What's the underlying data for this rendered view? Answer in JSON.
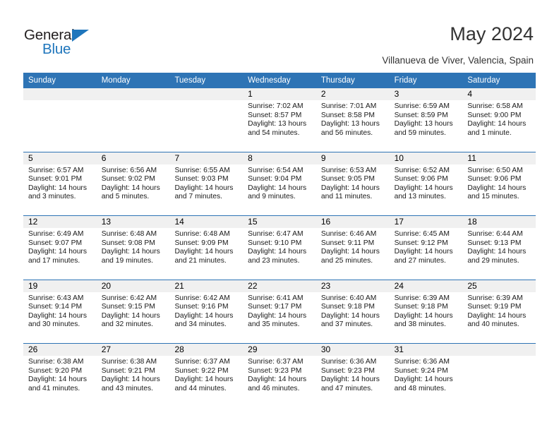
{
  "brand": {
    "name_top": "General",
    "name_bottom": "Blue",
    "triangle_color": "#1f76bc",
    "text_color": "#231f20"
  },
  "header": {
    "title": "May 2024",
    "subtitle": "Villanueva de Viver, Valencia, Spain"
  },
  "theme": {
    "header_blue": "#2e74b5",
    "daynum_band": "#f0f0f0",
    "cell_background": "#ffffff",
    "text": "#1a1a1a"
  },
  "weekdays": [
    "Sunday",
    "Monday",
    "Tuesday",
    "Wednesday",
    "Thursday",
    "Friday",
    "Saturday"
  ],
  "weeks": [
    [
      {
        "day": "",
        "sunrise": "",
        "sunset": "",
        "daylight1": "",
        "daylight2": "",
        "empty": true
      },
      {
        "day": "",
        "sunrise": "",
        "sunset": "",
        "daylight1": "",
        "daylight2": "",
        "empty": true
      },
      {
        "day": "",
        "sunrise": "",
        "sunset": "",
        "daylight1": "",
        "daylight2": "",
        "empty": true
      },
      {
        "day": "1",
        "sunrise": "Sunrise: 7:02 AM",
        "sunset": "Sunset: 8:57 PM",
        "daylight1": "Daylight: 13 hours",
        "daylight2": "and 54 minutes."
      },
      {
        "day": "2",
        "sunrise": "Sunrise: 7:01 AM",
        "sunset": "Sunset: 8:58 PM",
        "daylight1": "Daylight: 13 hours",
        "daylight2": "and 56 minutes."
      },
      {
        "day": "3",
        "sunrise": "Sunrise: 6:59 AM",
        "sunset": "Sunset: 8:59 PM",
        "daylight1": "Daylight: 13 hours",
        "daylight2": "and 59 minutes."
      },
      {
        "day": "4",
        "sunrise": "Sunrise: 6:58 AM",
        "sunset": "Sunset: 9:00 PM",
        "daylight1": "Daylight: 14 hours",
        "daylight2": "and 1 minute."
      }
    ],
    [
      {
        "day": "5",
        "sunrise": "Sunrise: 6:57 AM",
        "sunset": "Sunset: 9:01 PM",
        "daylight1": "Daylight: 14 hours",
        "daylight2": "and 3 minutes."
      },
      {
        "day": "6",
        "sunrise": "Sunrise: 6:56 AM",
        "sunset": "Sunset: 9:02 PM",
        "daylight1": "Daylight: 14 hours",
        "daylight2": "and 5 minutes."
      },
      {
        "day": "7",
        "sunrise": "Sunrise: 6:55 AM",
        "sunset": "Sunset: 9:03 PM",
        "daylight1": "Daylight: 14 hours",
        "daylight2": "and 7 minutes."
      },
      {
        "day": "8",
        "sunrise": "Sunrise: 6:54 AM",
        "sunset": "Sunset: 9:04 PM",
        "daylight1": "Daylight: 14 hours",
        "daylight2": "and 9 minutes."
      },
      {
        "day": "9",
        "sunrise": "Sunrise: 6:53 AM",
        "sunset": "Sunset: 9:05 PM",
        "daylight1": "Daylight: 14 hours",
        "daylight2": "and 11 minutes."
      },
      {
        "day": "10",
        "sunrise": "Sunrise: 6:52 AM",
        "sunset": "Sunset: 9:06 PM",
        "daylight1": "Daylight: 14 hours",
        "daylight2": "and 13 minutes."
      },
      {
        "day": "11",
        "sunrise": "Sunrise: 6:50 AM",
        "sunset": "Sunset: 9:06 PM",
        "daylight1": "Daylight: 14 hours",
        "daylight2": "and 15 minutes."
      }
    ],
    [
      {
        "day": "12",
        "sunrise": "Sunrise: 6:49 AM",
        "sunset": "Sunset: 9:07 PM",
        "daylight1": "Daylight: 14 hours",
        "daylight2": "and 17 minutes."
      },
      {
        "day": "13",
        "sunrise": "Sunrise: 6:48 AM",
        "sunset": "Sunset: 9:08 PM",
        "daylight1": "Daylight: 14 hours",
        "daylight2": "and 19 minutes."
      },
      {
        "day": "14",
        "sunrise": "Sunrise: 6:48 AM",
        "sunset": "Sunset: 9:09 PM",
        "daylight1": "Daylight: 14 hours",
        "daylight2": "and 21 minutes."
      },
      {
        "day": "15",
        "sunrise": "Sunrise: 6:47 AM",
        "sunset": "Sunset: 9:10 PM",
        "daylight1": "Daylight: 14 hours",
        "daylight2": "and 23 minutes."
      },
      {
        "day": "16",
        "sunrise": "Sunrise: 6:46 AM",
        "sunset": "Sunset: 9:11 PM",
        "daylight1": "Daylight: 14 hours",
        "daylight2": "and 25 minutes."
      },
      {
        "day": "17",
        "sunrise": "Sunrise: 6:45 AM",
        "sunset": "Sunset: 9:12 PM",
        "daylight1": "Daylight: 14 hours",
        "daylight2": "and 27 minutes."
      },
      {
        "day": "18",
        "sunrise": "Sunrise: 6:44 AM",
        "sunset": "Sunset: 9:13 PM",
        "daylight1": "Daylight: 14 hours",
        "daylight2": "and 29 minutes."
      }
    ],
    [
      {
        "day": "19",
        "sunrise": "Sunrise: 6:43 AM",
        "sunset": "Sunset: 9:14 PM",
        "daylight1": "Daylight: 14 hours",
        "daylight2": "and 30 minutes."
      },
      {
        "day": "20",
        "sunrise": "Sunrise: 6:42 AM",
        "sunset": "Sunset: 9:15 PM",
        "daylight1": "Daylight: 14 hours",
        "daylight2": "and 32 minutes."
      },
      {
        "day": "21",
        "sunrise": "Sunrise: 6:42 AM",
        "sunset": "Sunset: 9:16 PM",
        "daylight1": "Daylight: 14 hours",
        "daylight2": "and 34 minutes."
      },
      {
        "day": "22",
        "sunrise": "Sunrise: 6:41 AM",
        "sunset": "Sunset: 9:17 PM",
        "daylight1": "Daylight: 14 hours",
        "daylight2": "and 35 minutes."
      },
      {
        "day": "23",
        "sunrise": "Sunrise: 6:40 AM",
        "sunset": "Sunset: 9:18 PM",
        "daylight1": "Daylight: 14 hours",
        "daylight2": "and 37 minutes."
      },
      {
        "day": "24",
        "sunrise": "Sunrise: 6:39 AM",
        "sunset": "Sunset: 9:18 PM",
        "daylight1": "Daylight: 14 hours",
        "daylight2": "and 38 minutes."
      },
      {
        "day": "25",
        "sunrise": "Sunrise: 6:39 AM",
        "sunset": "Sunset: 9:19 PM",
        "daylight1": "Daylight: 14 hours",
        "daylight2": "and 40 minutes."
      }
    ],
    [
      {
        "day": "26",
        "sunrise": "Sunrise: 6:38 AM",
        "sunset": "Sunset: 9:20 PM",
        "daylight1": "Daylight: 14 hours",
        "daylight2": "and 41 minutes."
      },
      {
        "day": "27",
        "sunrise": "Sunrise: 6:38 AM",
        "sunset": "Sunset: 9:21 PM",
        "daylight1": "Daylight: 14 hours",
        "daylight2": "and 43 minutes."
      },
      {
        "day": "28",
        "sunrise": "Sunrise: 6:37 AM",
        "sunset": "Sunset: 9:22 PM",
        "daylight1": "Daylight: 14 hours",
        "daylight2": "and 44 minutes."
      },
      {
        "day": "29",
        "sunrise": "Sunrise: 6:37 AM",
        "sunset": "Sunset: 9:23 PM",
        "daylight1": "Daylight: 14 hours",
        "daylight2": "and 46 minutes."
      },
      {
        "day": "30",
        "sunrise": "Sunrise: 6:36 AM",
        "sunset": "Sunset: 9:23 PM",
        "daylight1": "Daylight: 14 hours",
        "daylight2": "and 47 minutes."
      },
      {
        "day": "31",
        "sunrise": "Sunrise: 6:36 AM",
        "sunset": "Sunset: 9:24 PM",
        "daylight1": "Daylight: 14 hours",
        "daylight2": "and 48 minutes."
      },
      {
        "day": "",
        "sunrise": "",
        "sunset": "",
        "daylight1": "",
        "daylight2": "",
        "empty": true
      }
    ]
  ]
}
